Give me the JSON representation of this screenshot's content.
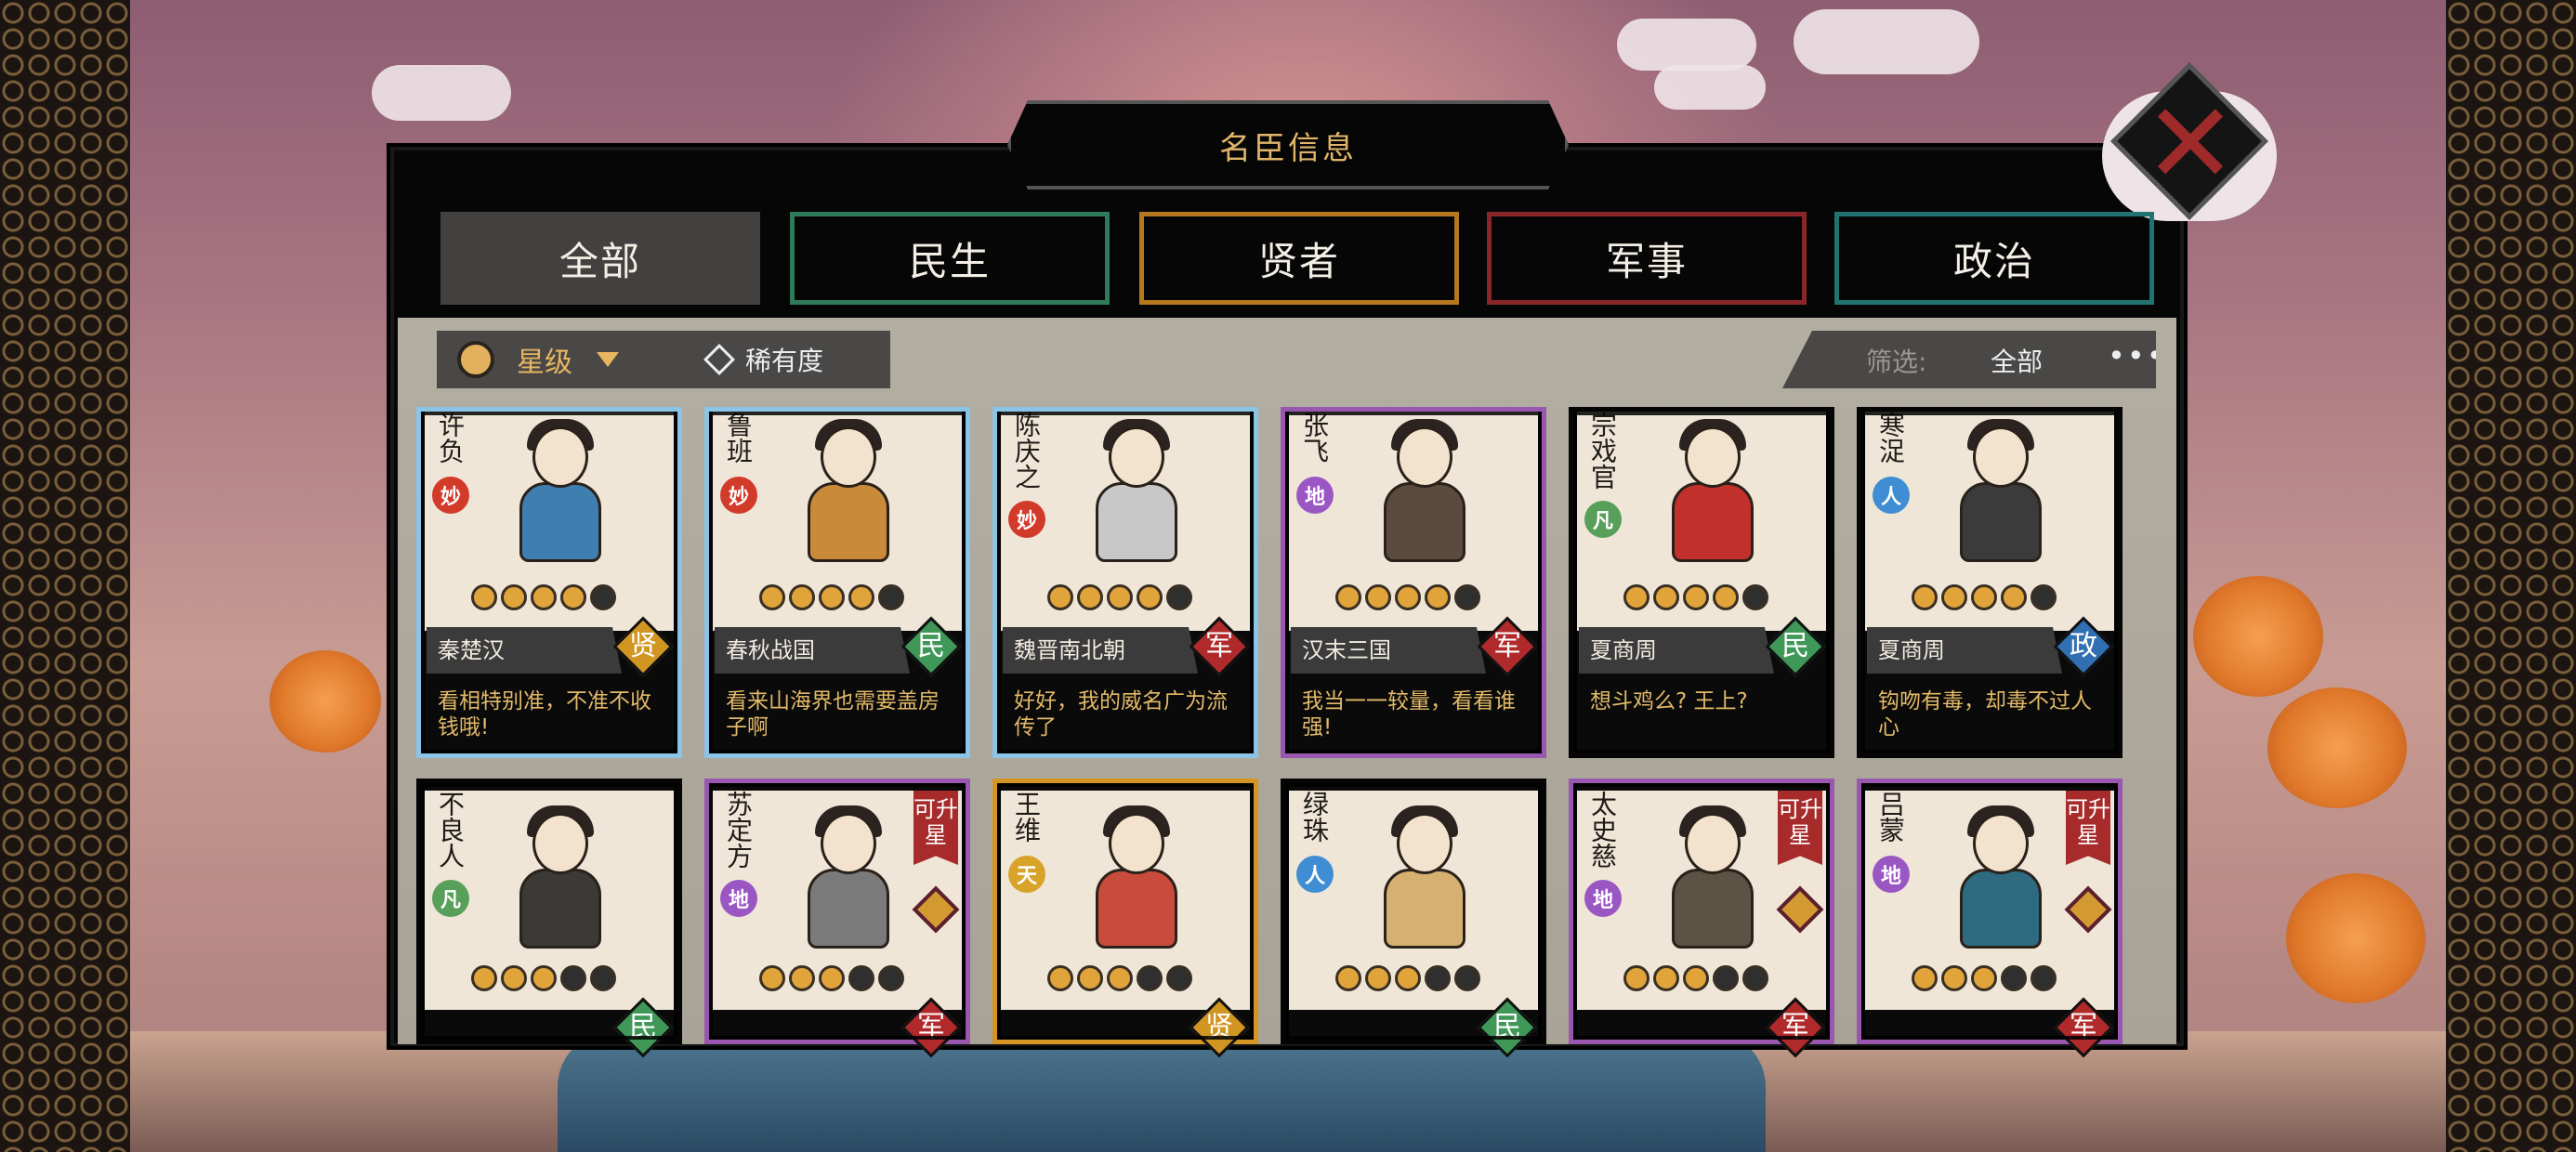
{
  "window_title": "名臣信息",
  "tabs": [
    {
      "label": "全部",
      "active": true
    },
    {
      "label": "民生",
      "active": false
    },
    {
      "label": "贤者",
      "active": false
    },
    {
      "label": "军事",
      "active": false
    },
    {
      "label": "政治",
      "active": false
    }
  ],
  "sort": {
    "label": "星级",
    "icon": "star-flower-icon",
    "rarity_label": "稀有度"
  },
  "filter": {
    "label": "筛选:",
    "value": "全部",
    "more": "•••"
  },
  "cards_row1": [
    {
      "name": "许负",
      "grade": "妙",
      "stars_on": 4,
      "stars_total": 5,
      "era": "秦楚汉",
      "category": "贤",
      "quote": "看相特别准，不准不收钱哦!",
      "border": "blue"
    },
    {
      "name": "鲁班",
      "grade": "妙",
      "stars_on": 4,
      "stars_total": 5,
      "era": "春秋战国",
      "category": "民",
      "quote": "看来山海界也需要盖房子啊",
      "border": "blue"
    },
    {
      "name": "陈庆之",
      "grade": "妙",
      "stars_on": 4,
      "stars_total": 5,
      "era": "魏晋南北朝",
      "category": "军",
      "quote": "好好，我的威名广为流传了",
      "border": "blue"
    },
    {
      "name": "张飞",
      "grade": "地",
      "stars_on": 4,
      "stars_total": 5,
      "era": "汉末三国",
      "category": "军",
      "quote": "我当一一较量，看看谁强!",
      "border": "purple"
    },
    {
      "name": "宗戏官",
      "grade": "凡",
      "stars_on": 4,
      "stars_total": 5,
      "era": "夏商周",
      "category": "民",
      "quote": "想斗鸡么? 王上?",
      "border": "black"
    },
    {
      "name": "寒浞",
      "grade": "人",
      "stars_on": 4,
      "stars_total": 5,
      "era": "夏商周",
      "category": "政",
      "quote": "钩吻有毒，却毒不过人心",
      "border": "black"
    }
  ],
  "cards_row2": [
    {
      "name": "不良人",
      "grade": "凡",
      "stars_on": 3,
      "stars_total": 5,
      "category": "民",
      "upgradeable": false,
      "border": "black"
    },
    {
      "name": "苏定方",
      "grade": "地",
      "stars_on": 3,
      "stars_total": 5,
      "category": "军",
      "upgradeable": true,
      "border": "purple"
    },
    {
      "name": "王维",
      "grade": "天",
      "stars_on": 3,
      "stars_total": 5,
      "category": "贤",
      "upgradeable": false,
      "border": "orange"
    },
    {
      "name": "绿珠",
      "grade": "人",
      "stars_on": 3,
      "stars_total": 5,
      "category": "民",
      "upgradeable": false,
      "border": "black"
    },
    {
      "name": "太史慈",
      "grade": "地",
      "stars_on": 3,
      "stars_total": 5,
      "category": "军",
      "upgradeable": true,
      "border": "purple"
    },
    {
      "name": "吕蒙",
      "grade": "地",
      "stars_on": 3,
      "stars_total": 5,
      "category": "军",
      "upgradeable": true,
      "border": "purple"
    }
  ],
  "upgrade_label": "可升星",
  "close_icon": "close-x-icon",
  "colors": {
    "gold_text": "#e0b56a",
    "tab_minsheng": "#2f7a5a",
    "tab_xianzhe": "#b5781e",
    "tab_junshi": "#8a2628",
    "tab_zhengzhi": "#217372"
  }
}
